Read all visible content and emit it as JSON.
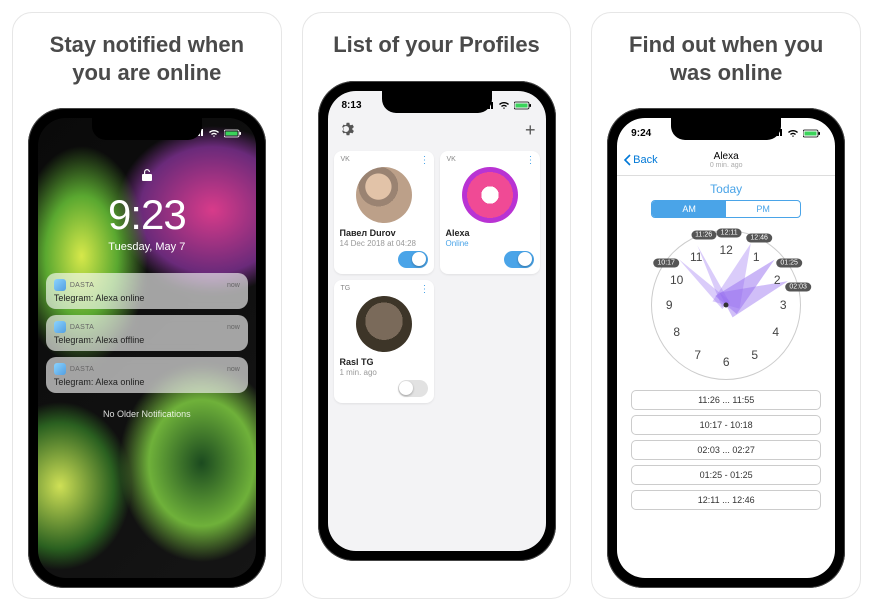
{
  "slides": [
    {
      "title": "Stay notified when you are online"
    },
    {
      "title": "List of your Profiles"
    },
    {
      "title": "Find out when you was online"
    }
  ],
  "lockscreen": {
    "time": "9:23",
    "date": "Tuesday, May 7",
    "no_older": "No Older Notifications",
    "notifications": [
      {
        "app": "DASTA",
        "time": "now",
        "body": "Telegram: Alexa online"
      },
      {
        "app": "DASTA",
        "time": "now",
        "body": "Telegram: Alexa offline"
      },
      {
        "app": "DASTA",
        "time": "now",
        "body": "Telegram: Alexa online"
      }
    ]
  },
  "profiles": {
    "status_time": "8:13",
    "cards": [
      {
        "tag": "VK",
        "name": "Павел Durov",
        "sub": "14 Dec 2018 at 04:28",
        "online": false,
        "toggle": true
      },
      {
        "tag": "VK",
        "name": "Alexa",
        "sub": "Online",
        "online": true,
        "toggle": true
      },
      {
        "tag": "TG",
        "name": "Rasl TG",
        "sub": "1 min. ago",
        "online": false,
        "toggle": false
      }
    ]
  },
  "detail": {
    "status_time": "9:24",
    "back_label": "Back",
    "title": "Alexa",
    "subtitle": "0 min. ago",
    "today_label": "Today",
    "segments": {
      "am": "AM",
      "pm": "PM"
    },
    "clock_numbers": [
      "12",
      "1",
      "2",
      "3",
      "4",
      "5",
      "6",
      "7",
      "8",
      "9",
      "10",
      "11"
    ],
    "clock_chips": [
      "11:26",
      "12:46",
      "01:25",
      "02:03",
      "10:17",
      "12:11"
    ],
    "ranges": [
      "11:26 ... 11:55",
      "10:17 - 10:18",
      "02:03 ... 02:27",
      "01:25 - 01:25",
      "12:11 ... 12:46"
    ]
  }
}
